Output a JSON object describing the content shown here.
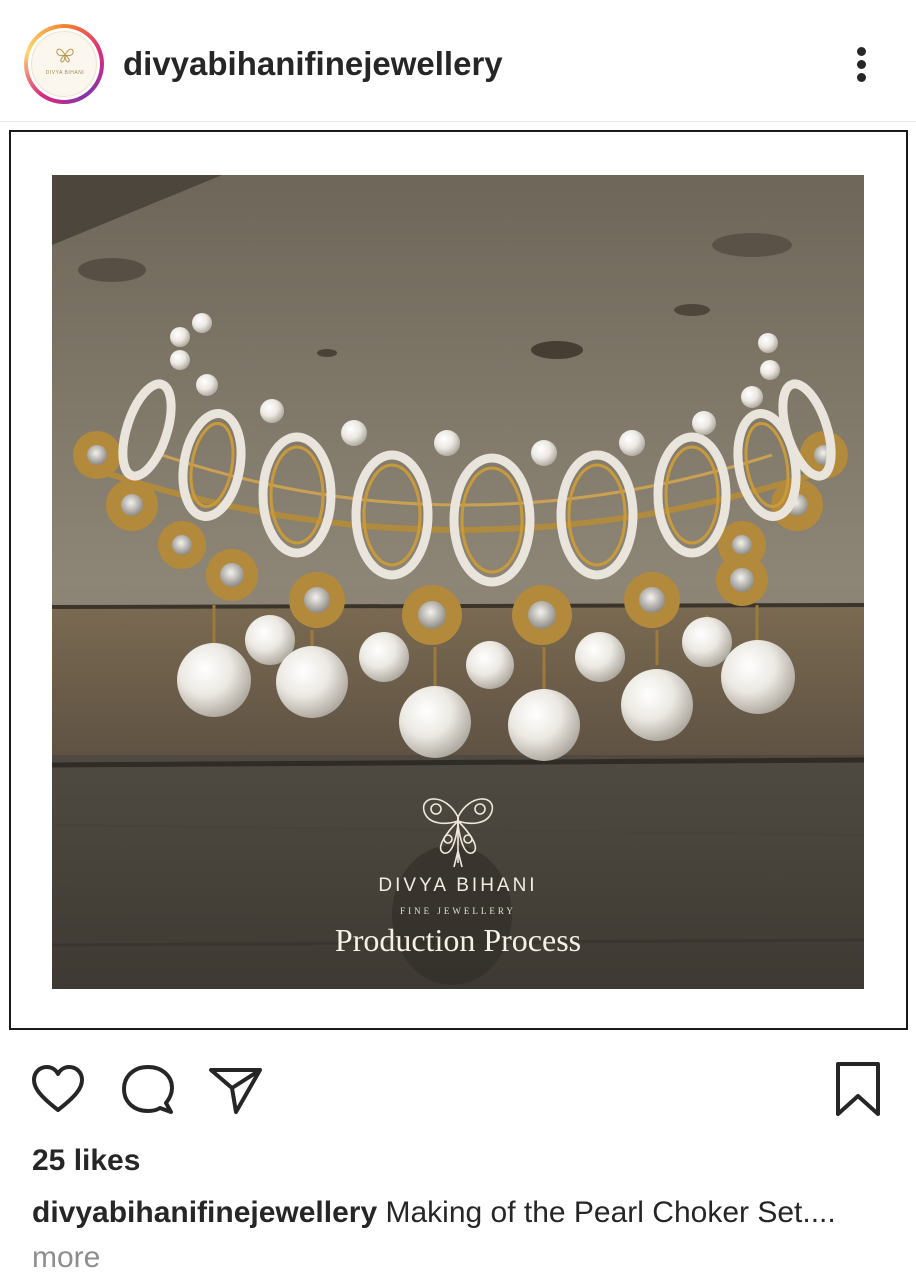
{
  "header": {
    "username": "divyabihanifinejewellery",
    "avatar_text": "DIVYA BIHANI",
    "avatar_icon": "butterfly-logo-icon",
    "menu_icon": "more-vertical-icon"
  },
  "post": {
    "photo_subject": "pearl-kundan-choker-necklace",
    "brand_name": "DIVYA BIHANI",
    "brand_subtitle": "FINE JEWELLERY",
    "tagline": "Production Process"
  },
  "actions": {
    "like_icon": "heart-icon",
    "comment_icon": "comment-icon",
    "share_icon": "paper-plane-icon",
    "save_icon": "bookmark-icon"
  },
  "likes": "25 likes",
  "caption": {
    "user": "divyabihanifinejewellery",
    "text": " Making of the Pearl Choker Set...",
    "ellipsis": ".",
    "more": " more"
  },
  "colors": {
    "text": "#262626",
    "secondary_text": "#8e8e8e",
    "story_ring_start": "#f58529",
    "story_ring_end": "#8134af",
    "gold": "#c99a3b"
  }
}
